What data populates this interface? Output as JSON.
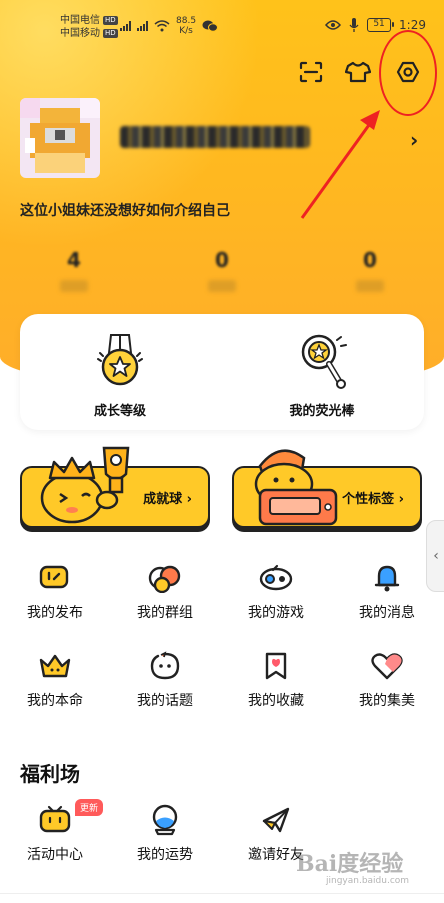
{
  "status_bar": {
    "carrier_1": "中国电信",
    "carrier_2": "中国移动",
    "hd": "HD",
    "net_speed_value": "88.5",
    "net_speed_unit": "K/s",
    "battery": "51",
    "time": "1:29"
  },
  "top_actions": [
    "scan-icon",
    "outfit-icon",
    "settings-icon"
  ],
  "profile": {
    "bio": "这位小姐妹还没想好如何介绍自己",
    "stats": [
      "4",
      "",
      "0",
      "0"
    ]
  },
  "level_card": {
    "items": [
      {
        "label": "成长等级",
        "icon": "medal-icon"
      },
      {
        "label": "我的荧光棒",
        "icon": "glow-stick-icon"
      }
    ]
  },
  "banners": [
    {
      "label": "成就球 ›"
    },
    {
      "label": "个性标签 ›"
    }
  ],
  "grid": [
    {
      "label": "我的发布",
      "icon": "publish-icon"
    },
    {
      "label": "我的群组",
      "icon": "group-icon"
    },
    {
      "label": "我的游戏",
      "icon": "game-icon"
    },
    {
      "label": "我的消息",
      "icon": "bell-icon"
    },
    {
      "label": "我的本命",
      "icon": "crown-icon"
    },
    {
      "label": "我的话题",
      "icon": "topic-icon"
    },
    {
      "label": "我的收藏",
      "icon": "bookmark-icon"
    },
    {
      "label": "我的集美",
      "icon": "heart-icon"
    }
  ],
  "welfare": {
    "title": "福利场",
    "new_badge": "更新",
    "items": [
      {
        "label": "活动中心",
        "icon": "tv-icon"
      },
      {
        "label": "我的运势",
        "icon": "crystal-ball-icon"
      },
      {
        "label": "邀请好友",
        "icon": "paper-plane-icon"
      }
    ]
  },
  "watermark": {
    "main": "Bai度经验",
    "sub": "jingyan.baidu.com"
  },
  "colors": {
    "hero": "#ffc21a",
    "highlight": "#ee2222",
    "badge": "#ff5a5a"
  }
}
